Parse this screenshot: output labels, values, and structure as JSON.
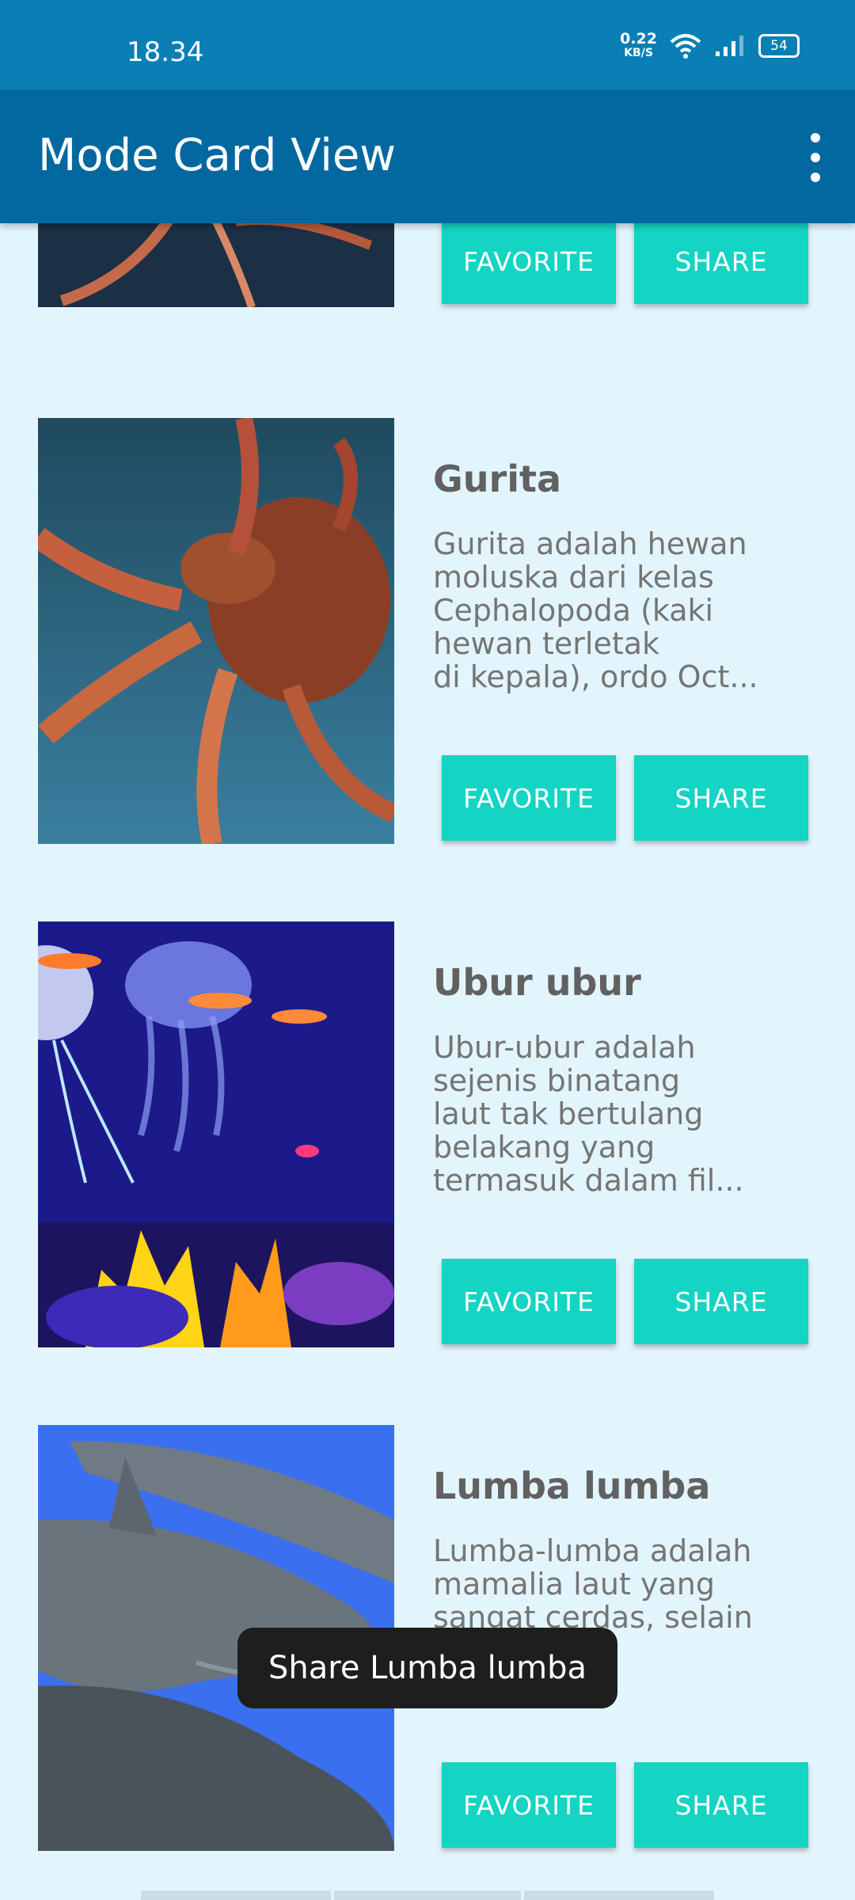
{
  "status_bar": {
    "time": "18.34",
    "net_speed_value": "0.22",
    "net_speed_unit": "KB/S",
    "battery": "54"
  },
  "app_bar": {
    "title": "Mode Card View"
  },
  "cards": [
    {
      "title": "",
      "description": "",
      "favorite_label": "FAVORITE",
      "share_label": "SHARE"
    },
    {
      "title": "Gurita",
      "description": "Gurita adalah hewan\nmoluska dari kelas\nCephalopoda (kaki\nhewan terletak\ndi kepala), ordo Oct...",
      "favorite_label": "FAVORITE",
      "share_label": "SHARE"
    },
    {
      "title": "Ubur ubur",
      "description": "Ubur-ubur adalah\nsejenis binatang\nlaut tak bertulang\nbelakang yang\ntermasuk dalam fil...",
      "favorite_label": "FAVORITE",
      "share_label": "SHARE"
    },
    {
      "title": "Lumba lumba",
      "description": "Lumba-lumba adalah\nmamalia laut yang\nsangat cerdas, selain\nalamiah\ngkapi tu...",
      "favorite_label": "FAVORITE",
      "share_label": "SHARE"
    }
  ],
  "toast": {
    "text": "Share Lumba lumba"
  }
}
